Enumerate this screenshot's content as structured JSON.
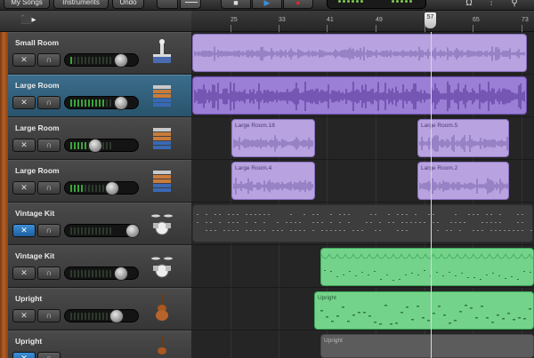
{
  "toolbar": {
    "my_songs_label": "My Songs",
    "instruments_label": "Instruments",
    "undo_label": "Undo"
  },
  "ruler": {
    "bar_numbers": [
      "25",
      "33",
      "41",
      "49",
      "57",
      "65",
      "73"
    ],
    "playhead_bar": "57"
  },
  "tracks": [
    {
      "name": "Small Room",
      "instrument_icon": "drum-machine-icon",
      "selected": false,
      "volume": 0.67,
      "meter_level": 0.1
    },
    {
      "name": "Large Room",
      "instrument_icon": "drum-machine-icon",
      "selected": true,
      "volume": 0.67,
      "meter_level": 0.8
    },
    {
      "name": "Large Room",
      "instrument_icon": "drum-machine-icon",
      "selected": false,
      "volume": 0.4,
      "meter_level": 0.4
    },
    {
      "name": "Large Room",
      "instrument_icon": "drum-machine-icon",
      "selected": false,
      "volume": 0.65,
      "meter_level": 0.35
    },
    {
      "name": "Vintage Kit",
      "instrument_icon": "drum-kit-icon",
      "selected": false,
      "volume": 0.83,
      "meter_level": 0.0
    },
    {
      "name": "Vintage Kit",
      "instrument_icon": "drum-kit-icon",
      "selected": false,
      "volume": 0.67,
      "meter_level": 0.0
    },
    {
      "name": "Upright",
      "instrument_icon": "upright-bass-icon",
      "selected": false,
      "volume": 0.6,
      "meter_level": 0.0
    },
    {
      "name": "Upright",
      "instrument_icon": "upright-bass-icon",
      "selected": false,
      "volume": 0.6,
      "meter_level": 0.0
    }
  ],
  "regions": [
    {
      "label": "",
      "lane": 0,
      "color": "#b8a3e0"
    },
    {
      "label": "",
      "lane": 1,
      "color": "#9b7ed6"
    },
    {
      "label": "Large Room.18",
      "lane": 2,
      "color": "#b8a3e0"
    },
    {
      "label": "Large Room.5",
      "lane": 2,
      "color": "#b8a3e0"
    },
    {
      "label": "Large Room.4",
      "lane": 3,
      "color": "#b8a3e0"
    },
    {
      "label": "Large Room.2",
      "lane": 3,
      "color": "#b8a3e0"
    },
    {
      "label": "",
      "lane": 4,
      "color": "#4a4a4a"
    },
    {
      "label": "",
      "lane": 5,
      "color": "#74d38a"
    },
    {
      "label": "Upright",
      "lane": 6,
      "color": "#74d38a"
    },
    {
      "label": "Upright",
      "lane": 7,
      "color": "#5c5c5c"
    }
  ],
  "colors": {
    "selected_track": "#29536c",
    "meter_green": "#3aa53a",
    "meter_red": "#d93a2a",
    "playback_blue": "#3b8fd8",
    "record_red": "#d8282a"
  }
}
